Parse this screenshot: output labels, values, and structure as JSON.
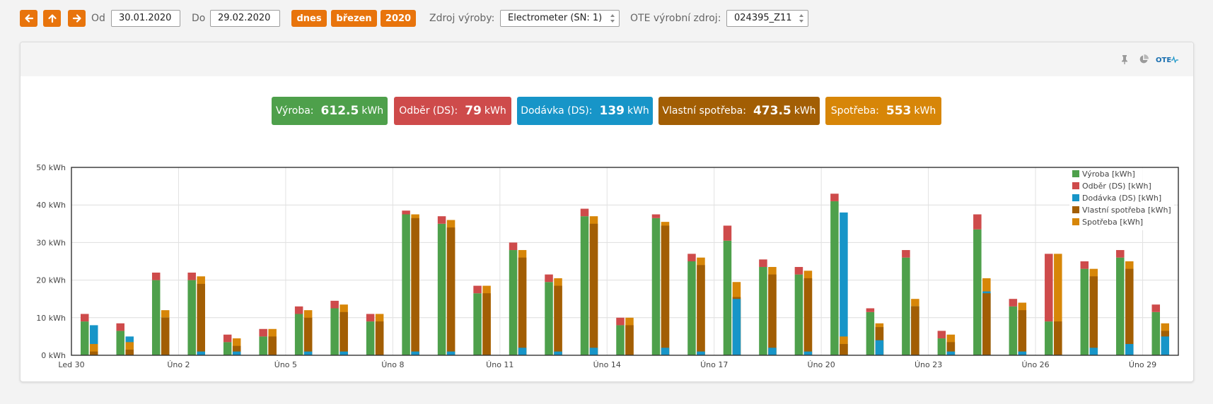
{
  "toolbar": {
    "from_label": "Od",
    "from_value": "30.01.2020",
    "to_label": "Do",
    "to_value": "29.02.2020",
    "today_label": "dnes",
    "month_label": "březen",
    "year_label": "2020",
    "source_label": "Zdroj výroby:",
    "source_value": "Electrometer (SN: 1)",
    "ote_label": "OTE výrobní zdroj:",
    "ote_value": "024395_Z11",
    "accent": "#e8740c"
  },
  "panel_icons": {
    "pin": "pin-icon",
    "pie": "pie-chart-icon",
    "ote_logo_text": "OTE"
  },
  "summary": [
    {
      "label": "Výroba:",
      "value": "612.5",
      "unit": "kWh",
      "color": "#4ea04b"
    },
    {
      "label": "Odběr (DS):",
      "value": "79",
      "unit": "kWh",
      "color": "#ce4b4b"
    },
    {
      "label": "Dodávka (DS):",
      "value": "139",
      "unit": "kWh",
      "color": "#1795c8"
    },
    {
      "label": "Vlastní spotřeba:",
      "value": "473.5",
      "unit": "kWh",
      "color": "#a25e04"
    },
    {
      "label": "Spotřeba:",
      "value": "553",
      "unit": "kWh",
      "color": "#d78608"
    }
  ],
  "chart_data": {
    "type": "bar",
    "ylim": [
      0,
      50
    ],
    "yticks": [
      0,
      10,
      20,
      30,
      40,
      50
    ],
    "yunit": "kWh",
    "grid": true,
    "legend_position": "top-right",
    "xtick_labels": [
      {
        "index": 0,
        "label": "Led 30"
      },
      {
        "index": 3,
        "label": "Úno 2"
      },
      {
        "index": 6,
        "label": "Úno 5"
      },
      {
        "index": 9,
        "label": "Úno 8"
      },
      {
        "index": 12,
        "label": "Úno 11"
      },
      {
        "index": 15,
        "label": "Úno 14"
      },
      {
        "index": 18,
        "label": "Úno 17"
      },
      {
        "index": 21,
        "label": "Úno 20"
      },
      {
        "index": 24,
        "label": "Úno 23"
      },
      {
        "index": 27,
        "label": "Úno 26"
      },
      {
        "index": 30,
        "label": "Úno 29"
      }
    ],
    "series": [
      {
        "name": "Výroba [kWh]",
        "color": "#4ea04b",
        "values": [
          9,
          6.5,
          20,
          20,
          3.5,
          5,
          11,
          12.5,
          9,
          37.5,
          35,
          16.5,
          28,
          19.5,
          37,
          8,
          36.5,
          25,
          30.5,
          23.5,
          21.5,
          41,
          11.5,
          26,
          4.5,
          33.5,
          13,
          9,
          23,
          26,
          11.5
        ]
      },
      {
        "name": "Odběr (DS) [kWh]",
        "color": "#ce4b4b",
        "values": [
          2,
          2,
          2,
          2,
          2,
          2,
          2,
          2,
          2,
          1,
          2,
          2,
          2,
          2,
          2,
          2,
          1,
          2,
          4,
          2,
          2,
          2,
          1,
          2,
          2,
          4,
          2,
          18,
          2,
          2,
          2
        ]
      },
      {
        "name": "Dodávka (DS) [kWh]",
        "color": "#1795c8",
        "values": [
          8,
          5,
          10,
          1,
          1,
          0,
          1,
          1,
          0,
          1,
          1,
          0,
          2,
          1,
          2,
          0,
          2,
          1,
          15,
          2,
          1,
          38,
          4,
          13,
          1,
          17,
          1,
          0,
          2,
          3,
          5
        ]
      },
      {
        "name": "Vlastní spotřeba [kWh]",
        "color": "#a25e04",
        "values": [
          1,
          1.5,
          10,
          19,
          2.5,
          5,
          10,
          11.5,
          9,
          36.5,
          34,
          16.5,
          26,
          18.5,
          35,
          8,
          34.5,
          24,
          15.5,
          21.5,
          20.5,
          3,
          7.5,
          13,
          3.5,
          16.5,
          12,
          9,
          21,
          23,
          6.5
        ]
      },
      {
        "name": "Spotřeba [kWh]",
        "color": "#d78608",
        "values": [
          3,
          3.5,
          12,
          21,
          4.5,
          7,
          12,
          13.5,
          11,
          37.5,
          36,
          18.5,
          28,
          20.5,
          37,
          10,
          35.5,
          26,
          19.5,
          23.5,
          22.5,
          5,
          8.5,
          15,
          5.5,
          20.5,
          14,
          27,
          23,
          25,
          8.5
        ]
      }
    ],
    "stacks": [
      [
        "Výroba [kWh]",
        "Odběr (DS) [kWh]"
      ],
      [
        "Dodávka (DS) [kWh]",
        "Vlastní spotřeba [kWh]",
        "Spotřeba [kWh]"
      ]
    ]
  }
}
